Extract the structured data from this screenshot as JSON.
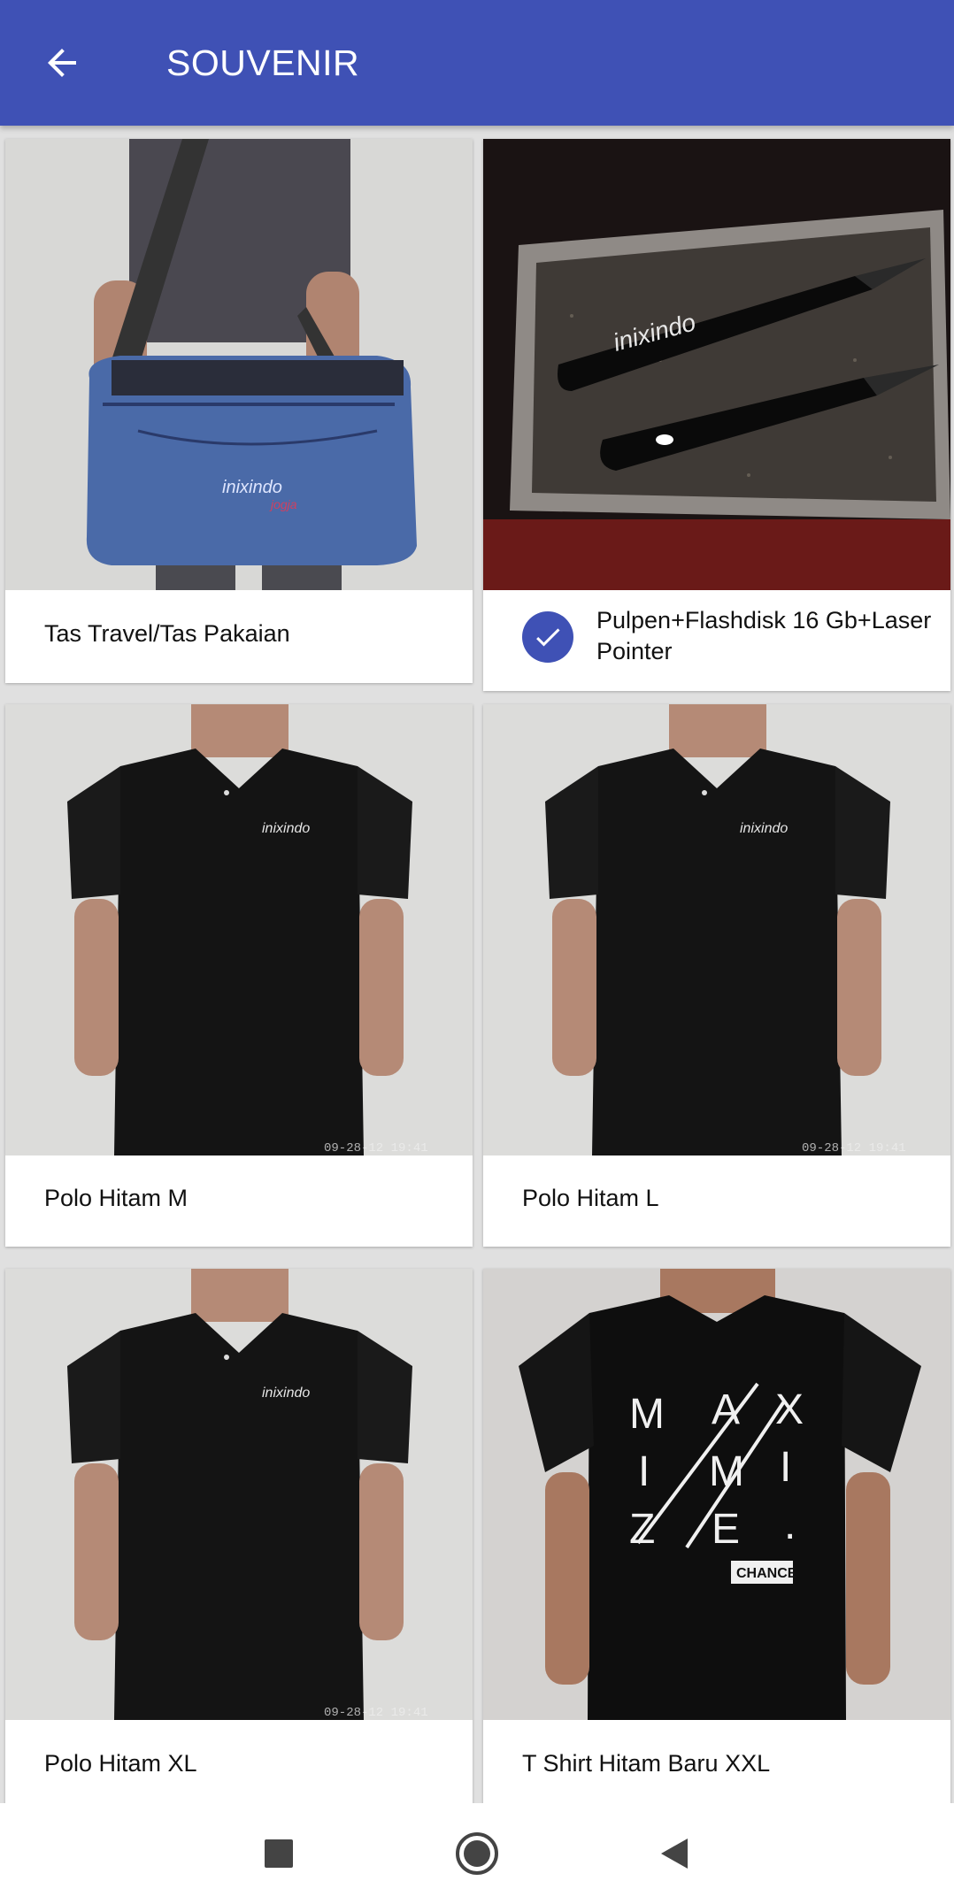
{
  "appbar": {
    "title": "SOUVENIR",
    "back_icon": "arrow-back-icon",
    "color": "#3f51b5"
  },
  "products": [
    {
      "name": "Tas Travel/Tas Pakaian",
      "selected": false,
      "image": "blue travel bag"
    },
    {
      "name": "Pulpen+Flashdisk 16 Gb+Laser Pointer",
      "selected": true,
      "image": "pen and flashdisk in tin box"
    },
    {
      "name": "Polo Hitam M",
      "selected": false,
      "image": "black polo shirt",
      "image_stamp": "09-28-12 19:41"
    },
    {
      "name": "Polo Hitam L",
      "selected": false,
      "image": "black polo shirt",
      "image_stamp": "09-28-12 19:41"
    },
    {
      "name": "Polo Hitam XL",
      "selected": false,
      "image": "black polo shirt",
      "image_stamp": "09-28-12 19:41"
    },
    {
      "name": "T Shirt Hitam Baru XXL",
      "selected": false,
      "image": "black t-shirt with MAXIMIZE print"
    }
  ],
  "navbar": {
    "recents_icon": "square-recents-icon",
    "home_icon": "circle-home-icon",
    "back_icon": "triangle-back-icon"
  }
}
